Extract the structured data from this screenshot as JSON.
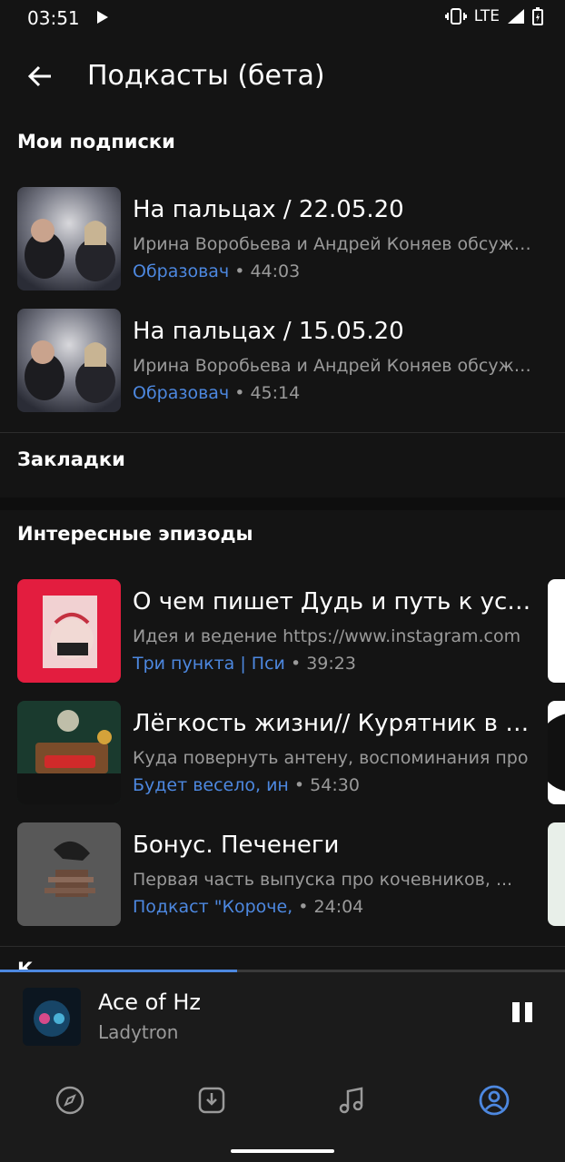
{
  "status_bar": {
    "time": "03:51",
    "network": "LTE"
  },
  "header": {
    "title": "Подкасты (бета)"
  },
  "sections": {
    "subscriptions": {
      "title": "Мои подписки"
    },
    "bookmarks": {
      "title": "Закладки"
    },
    "interesting": {
      "title": "Интересные эпизоды"
    },
    "next_partial": {
      "title": "К"
    }
  },
  "subscriptions": [
    {
      "title": "На пальцах / 22.05.20",
      "description": "Ирина Воробьева и Андрей Коняев обсуждают",
      "author": "Образовач",
      "duration": "44:03"
    },
    {
      "title": "На пальцах / 15.05.20",
      "description": "Ирина Воробьева и Андрей Коняев обсуждают",
      "author": "Образовач",
      "duration": "45:14"
    }
  ],
  "interesting": [
    {
      "title": "О чем пишет Дудь и путь к успеху",
      "description": "Идея и ведение https://www.instagram.com",
      "author": "Три пункта | Пси",
      "duration": "39:23"
    },
    {
      "title": "Лёгкость жизни// Курятник в квартире",
      "description": "Куда повернуть антену, воспоминания про",
      "author": "Будет весело, ин",
      "duration": "54:30"
    },
    {
      "title": "Бонус. Печенеги",
      "description": "Первая часть выпуска про кочевников, ...",
      "author": "Подкаст \"Короче,",
      "duration": "24:04"
    }
  ],
  "separator": "•",
  "player": {
    "title": "Ace of Hz",
    "artist": "Ladytron",
    "progress": 0.42
  },
  "nav": {
    "items": [
      {
        "name": "discover",
        "icon": "compass-icon"
      },
      {
        "name": "downloads",
        "icon": "download-icon"
      },
      {
        "name": "music",
        "icon": "music-note-icon"
      },
      {
        "name": "profile",
        "icon": "account-icon",
        "active": true
      }
    ]
  },
  "colors": {
    "accent": "#4d88e0",
    "background": "#141414",
    "secondary_text": "#9a9a9a"
  }
}
